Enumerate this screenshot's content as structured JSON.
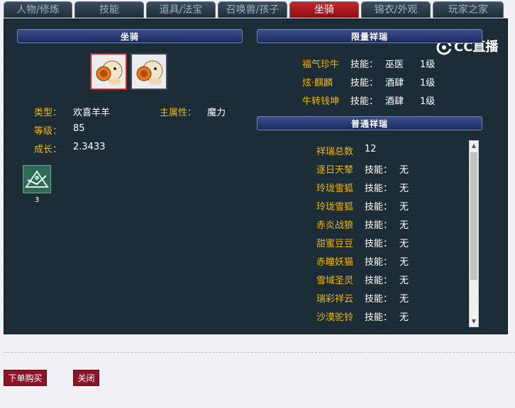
{
  "tabs": [
    "人物/修炼",
    "技能",
    "道具/法宝",
    "召唤兽/孩子",
    "坐骑",
    "锦衣/外观",
    "玩家之家"
  ],
  "active_tab": "坐骑",
  "logo": {
    "text": "CC直播"
  },
  "left": {
    "header": "坐骑",
    "info": {
      "type_label": "类型：",
      "type_value": "欢喜羊羊",
      "main_attr_label": "主属性：",
      "main_attr_value": "魔力",
      "level_label": "等级：",
      "level_value": "85",
      "growth_label": "成长：",
      "growth_value": "2.3433"
    },
    "item_count": "3"
  },
  "limited": {
    "header": "限量祥瑞",
    "items": [
      {
        "name": "福气珍牛",
        "skill_label": "技能：",
        "skill": "巫医",
        "level": "1级"
      },
      {
        "name": "炫·麒麟",
        "skill_label": "技能：",
        "skill": "酒肆",
        "level": "1级"
      },
      {
        "name": "牛转钱坤",
        "skill_label": "技能：",
        "skill": "酒肆",
        "level": "1级"
      }
    ]
  },
  "normal": {
    "header": "普通祥瑞",
    "total_label": "祥瑞总数",
    "total_value": "12",
    "items": [
      {
        "name": "逐日天辇",
        "skill_label": "技能：",
        "skill": "无"
      },
      {
        "name": "玲珑雪狐",
        "skill_label": "技能：",
        "skill": "无"
      },
      {
        "name": "玲珑雪狐",
        "skill_label": "技能：",
        "skill": "无"
      },
      {
        "name": "赤炎战狼",
        "skill_label": "技能：",
        "skill": "无"
      },
      {
        "name": "甜蜜豆豆",
        "skill_label": "技能：",
        "skill": "无"
      },
      {
        "name": "赤瞳妖猫",
        "skill_label": "技能：",
        "skill": "无"
      },
      {
        "name": "雪域圣灵",
        "skill_label": "技能：",
        "skill": "无"
      },
      {
        "name": "瑞彩祥云",
        "skill_label": "技能：",
        "skill": "无"
      },
      {
        "name": "沙漠驼铃",
        "skill_label": "技能：",
        "skill": "无"
      }
    ]
  },
  "buttons": {
    "order": "下单购买",
    "close": "关闭"
  }
}
